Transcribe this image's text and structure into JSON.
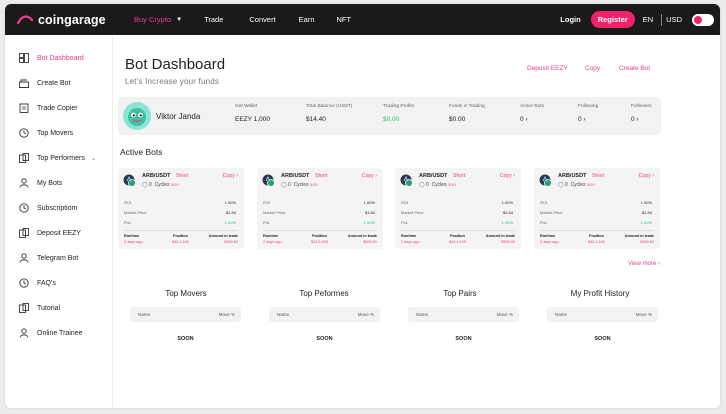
{
  "brand": {
    "name": "coingarage",
    "accent": "#e83e8c"
  },
  "nav": [
    {
      "label": "Buy Crypto",
      "has_dropdown": true,
      "active": true
    },
    {
      "label": "Trade"
    },
    {
      "label": "Convert"
    },
    {
      "label": "Earn"
    },
    {
      "label": "NFT"
    }
  ],
  "header_right": {
    "login": "Login",
    "register": "Register",
    "lang": "EN",
    "currency": "USD"
  },
  "sidebar": [
    {
      "label": "Bot Dashboard",
      "icon": "dashboard-icon",
      "active": true
    },
    {
      "label": "Create Bot",
      "icon": "create-bot-icon"
    },
    {
      "label": "Trade Copier",
      "icon": "clipboard-icon"
    },
    {
      "label": "Top Movers",
      "icon": "history-icon"
    },
    {
      "label": "Top Performers",
      "icon": "performers-icon",
      "has_dropdown": true
    },
    {
      "label": "My Bots",
      "icon": "user-icon"
    },
    {
      "label": "Subscriptiom",
      "icon": "history-icon"
    },
    {
      "label": "Deposit EEZY",
      "icon": "deposit-icon"
    },
    {
      "label": "Telegram Bot",
      "icon": "user-icon"
    },
    {
      "label": "FAQ's",
      "icon": "history-icon"
    },
    {
      "label": "Tutorial",
      "icon": "tutorial-icon"
    },
    {
      "label": "Online Trainee",
      "icon": "user-icon"
    }
  ],
  "page": {
    "title": "Bot Dashboard",
    "subtitle": "Let's Increase your funds",
    "actions": [
      "Deposit EEZY",
      "Copy",
      "Create Bot"
    ]
  },
  "profile": {
    "name": "Viktor Janda",
    "stats": [
      {
        "label": "Get Wallet",
        "value": "EEZY 1,000"
      },
      {
        "label": "Total Balance (USDT)",
        "value": "$14.40"
      },
      {
        "label": "Trading Profits",
        "value": "$0.00",
        "color": "green"
      },
      {
        "label": "Funds in Trading",
        "value": "$0.00"
      },
      {
        "label": "Active Bots",
        "value": "0 ›"
      },
      {
        "label": "Following",
        "value": "0 ›"
      },
      {
        "label": "Followers",
        "value": "0 ›"
      }
    ]
  },
  "active_bots_title": "Active Bots",
  "bots": [
    {
      "pair": "ARB/USDT",
      "side": "Short",
      "copy": "Copy ›",
      "followers": "0",
      "cycles_label": "Cycles",
      "cycles": "3/10",
      "roi_label": "ROI",
      "roi": "1.00%",
      "mp_label": "Market Price",
      "market_price": "$1.84",
      "pnl_label": "PnL",
      "pnl": "1.00%",
      "runtime_label": "Runtime",
      "runtime": "2 days ago",
      "position_label": "Position",
      "position": "$43.1.495",
      "amount_label": "Amount in trade",
      "amount": "$999.89"
    },
    {
      "pair": "ARB/USDT",
      "side": "Short",
      "copy": "Copy ›",
      "followers": "0",
      "cycles_label": "Cycles",
      "cycles": "3/10",
      "roi_label": "ROI",
      "roi": "1.00%",
      "mp_label": "Market Price",
      "market_price": "$1.84",
      "pnl_label": "PnL",
      "pnl": "1.00%",
      "runtime_label": "Runtime",
      "runtime": "2 days ago",
      "position_label": "Position",
      "position": "$43.1.495",
      "amount_label": "Amount in trade",
      "amount": "$999.89"
    },
    {
      "pair": "ARB/USDT",
      "side": "Short",
      "copy": "Copy ›",
      "followers": "0",
      "cycles_label": "Cycles",
      "cycles": "3/10",
      "roi_label": "ROI",
      "roi": "1.00%",
      "mp_label": "Market Price",
      "market_price": "$1.84",
      "pnl_label": "PnL",
      "pnl": "1.00%",
      "runtime_label": "Runtime",
      "runtime": "2 days ago",
      "position_label": "Position",
      "position": "$43.1.495",
      "amount_label": "Amount in trade",
      "amount": "$999.89"
    },
    {
      "pair": "ARB/USDT",
      "side": "Short",
      "copy": "Copy ›",
      "followers": "0",
      "cycles_label": "Cycles",
      "cycles": "3/10",
      "roi_label": "ROI",
      "roi": "1.00%",
      "mp_label": "Market Price",
      "market_price": "$1.84",
      "pnl_label": "PnL",
      "pnl": "1.00%",
      "runtime_label": "Runtime",
      "runtime": "2 days ago",
      "position_label": "Position",
      "position": "$43.1.495",
      "amount_label": "Amount in trade",
      "amount": "$999.89"
    }
  ],
  "view_more": "View more ›",
  "panels": [
    {
      "title": "Top Movers",
      "col1": "Name",
      "col2": "Move %",
      "status": "SOON"
    },
    {
      "title": "Top Peformes",
      "col1": "Name",
      "col2": "Move %",
      "status": "SOON"
    },
    {
      "title": "Top Pairs",
      "col1": "Name",
      "col2": "Move %",
      "status": "SOON"
    },
    {
      "title": "My Profit History",
      "col1": "Name",
      "col2": "Move %",
      "status": "SOON"
    }
  ]
}
